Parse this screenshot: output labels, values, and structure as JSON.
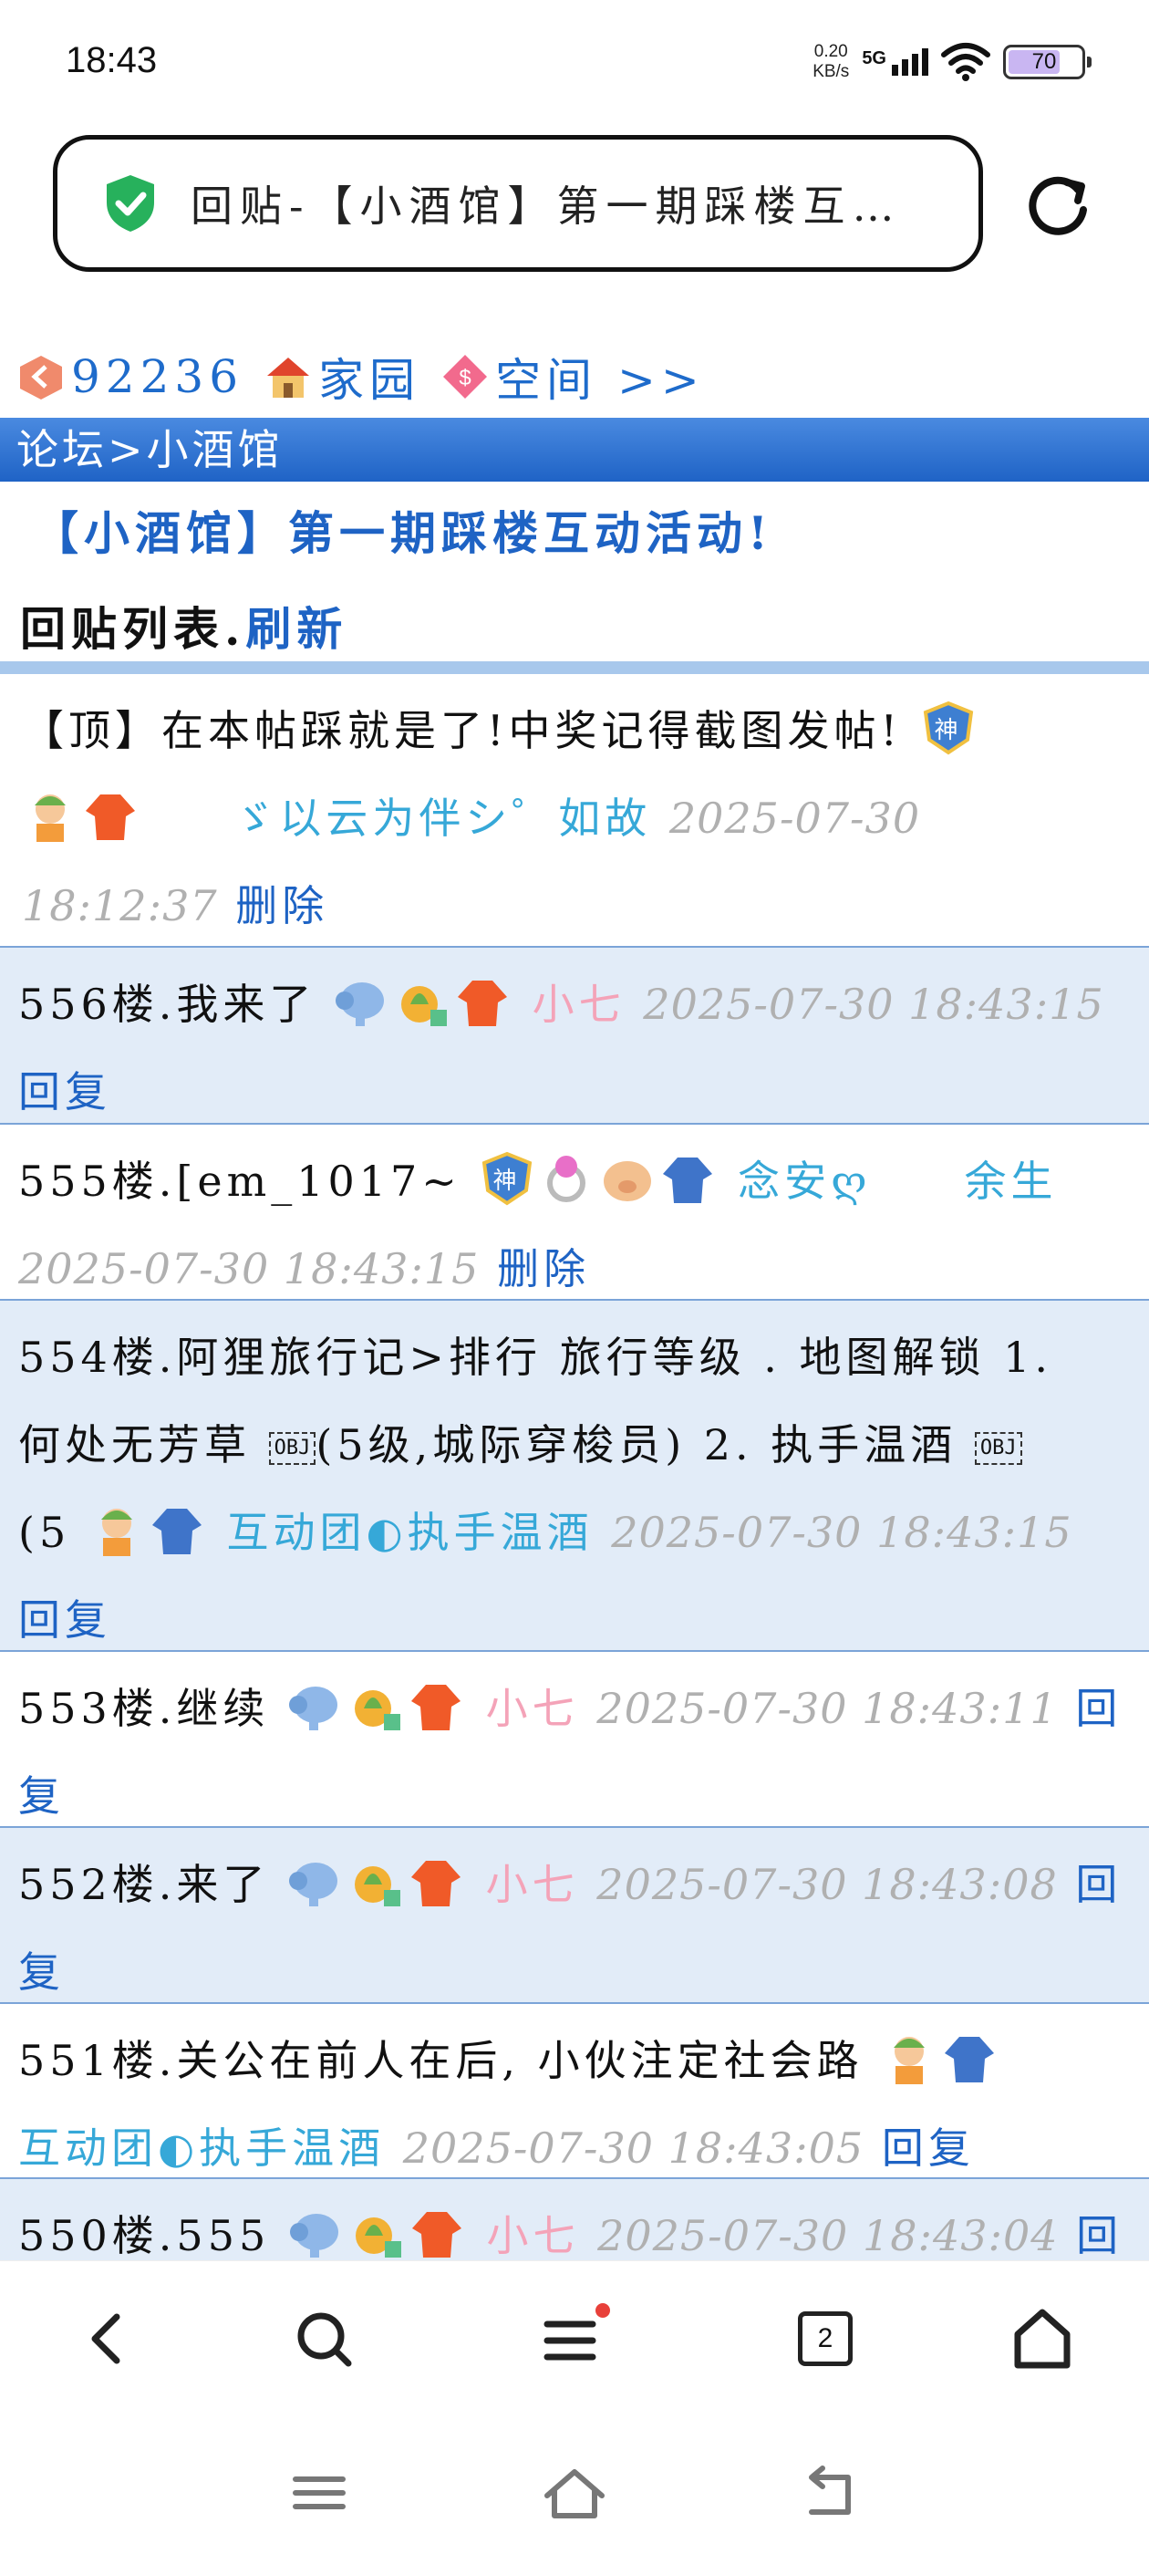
{
  "status_bar": {
    "time": "18:43",
    "net_speed_value": "0.20",
    "net_speed_unit": "KB/s",
    "network": "5G",
    "battery": "70"
  },
  "address_bar": {
    "title": "回贴-【小酒馆】第一期踩楼互…"
  },
  "user_bar": {
    "points": "92236",
    "home_link": "家园",
    "space_link": "空间 >>"
  },
  "breadcrumb": "论坛>小酒馆",
  "post_title": "【小酒馆】第一期踩楼互动活动!",
  "list_header": {
    "label": "回贴列表.",
    "refresh": "刷新"
  },
  "pinned": {
    "content": "【顶】在本帖踩就是了!中奖记得截图发帖!",
    "author": "ゞ以云为伴シ゜如故",
    "time_date": "2025-07-30",
    "time_clock": "18:12:37",
    "action": "删除"
  },
  "replies": [
    {
      "floor": "556楼.",
      "content": "我来了",
      "author": "小七",
      "time": "2025-07-30 18:43:15",
      "action": "回复"
    },
    {
      "floor": "555楼.",
      "content": "[em_1017~",
      "author": "念安ღ　　余生",
      "time": "2025-07-30 18:43:15",
      "action": "删除"
    },
    {
      "floor": "554楼.",
      "content_1": "阿狸旅行记>排行 旅行等级 . 地图解锁 1.",
      "content_2": "何处无芳草",
      "obj": "OBJ",
      "content_3": "(5级,城际穿梭员) 2. 执手温酒",
      "content_4": "(5",
      "author": "互动团◐执手温酒",
      "time": "2025-07-30 18:43:15",
      "action": "回复"
    },
    {
      "floor": "553楼.",
      "content": "继续",
      "author": "小七",
      "time": "2025-07-30 18:43:11",
      "action": "回复"
    },
    {
      "floor": "552楼.",
      "content": "来了",
      "author": "小七",
      "time": "2025-07-30 18:43:08",
      "action": "回复"
    },
    {
      "floor": "551楼.",
      "content": "关公在前人在后, 小伙注定社会路",
      "author": "互动团◐执手温酒",
      "time": "2025-07-30 18:43:05",
      "action": "回复"
    },
    {
      "floor": "550楼.",
      "content": "555",
      "author": "小七",
      "time": "2025-07-30 18:43:04",
      "action": "回复"
    }
  ],
  "bottom_nav": {
    "tab_count": "2",
    "icons": [
      "back-icon",
      "search-icon",
      "menu-icon",
      "tabs-icon",
      "home-icon"
    ]
  },
  "colors": {
    "link": "#1e63c4",
    "breadcrumb_bg": "#2a6fd0",
    "row_alt": "#e2ecf8",
    "author": "#36a8d8",
    "author_pink": "#f4a3b8",
    "time": "#b0b0b0"
  }
}
